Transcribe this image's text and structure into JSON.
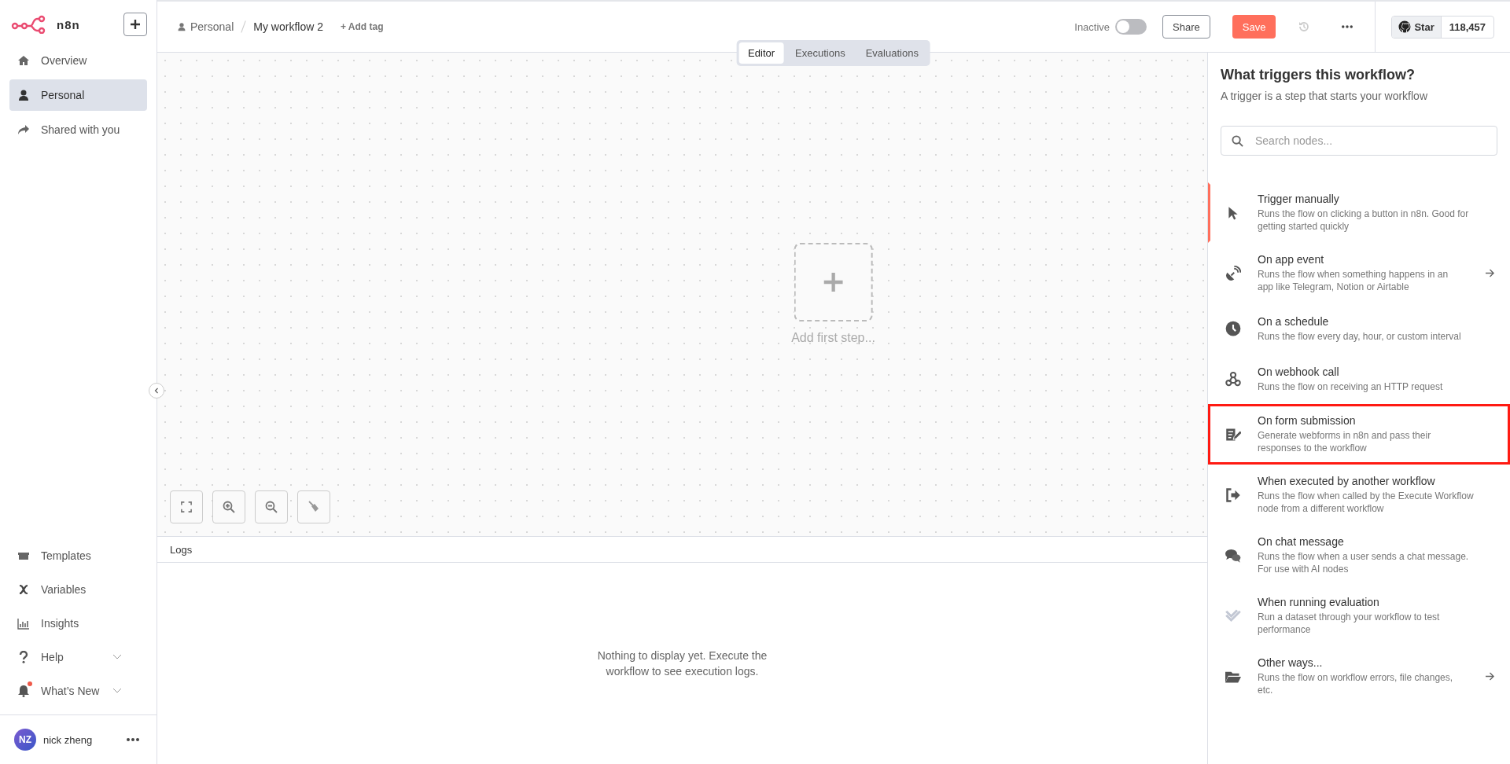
{
  "sidebar": {
    "logo_text": "n8n",
    "top_items": [
      {
        "kind": "home",
        "label": "Overview",
        "selected": false
      },
      {
        "kind": "user",
        "label": "Personal",
        "selected": true
      },
      {
        "kind": "share",
        "label": "Shared with you",
        "selected": false
      }
    ],
    "bottom_items": [
      {
        "kind": "box",
        "label": "Templates",
        "expandable": false,
        "notification": false
      },
      {
        "kind": "variable",
        "label": "Variables",
        "expandable": false,
        "notification": false
      },
      {
        "kind": "chart",
        "label": "Insights",
        "expandable": false,
        "notification": false
      },
      {
        "kind": "question",
        "label": "Help",
        "expandable": true,
        "notification": false
      },
      {
        "kind": "bell",
        "label": "What’s New",
        "expandable": true,
        "notification": true
      }
    ],
    "user": {
      "initials": "NZ",
      "name": "nick zheng"
    }
  },
  "header": {
    "project": "Personal",
    "workflow": "My workflow 2",
    "add_tag": "+ Add tag",
    "status_label": "Inactive",
    "active": false,
    "share": "Share",
    "save": "Save",
    "github": {
      "label": "Star",
      "count": "118,457"
    }
  },
  "view_tabs": [
    {
      "label": "Editor",
      "selected": true
    },
    {
      "label": "Executions",
      "selected": false
    },
    {
      "label": "Evaluations",
      "selected": false
    }
  ],
  "canvas": {
    "add_first_step": "Add first step..."
  },
  "logs": {
    "title": "Logs",
    "empty_message": "Nothing to display yet. Execute the workflow to see execution logs."
  },
  "trigger_panel": {
    "title": "What triggers this workflow?",
    "subtitle": "A trigger is a step that starts your workflow",
    "search": {
      "placeholder": "Search nodes..."
    },
    "items": [
      {
        "kind": "pointer",
        "title": "Trigger manually",
        "description": "Runs the flow on clicking a button in n8n. Good for getting started quickly",
        "selected": true,
        "has_arrow": false,
        "highlighted": false
      },
      {
        "kind": "satellite",
        "title": "On app event",
        "description": "Runs the flow when something happens in an app like Telegram, Notion or Airtable",
        "selected": false,
        "has_arrow": true,
        "highlighted": false
      },
      {
        "kind": "clock",
        "title": "On a schedule",
        "description": "Runs the flow every day, hour, or custom interval",
        "selected": false,
        "has_arrow": false,
        "highlighted": false
      },
      {
        "kind": "webhook",
        "title": "On webhook call",
        "description": "Runs the flow on receiving an HTTP request",
        "selected": false,
        "has_arrow": false,
        "highlighted": false
      },
      {
        "kind": "form",
        "title": "On form submission",
        "description": "Generate webforms in n8n and pass their responses to the workflow",
        "selected": false,
        "has_arrow": false,
        "highlighted": true
      },
      {
        "kind": "exit",
        "title": "When executed by another workflow",
        "description": "Runs the flow when called by the Execute Workflow node from a different workflow",
        "selected": false,
        "has_arrow": false,
        "highlighted": false
      },
      {
        "kind": "chat",
        "title": "On chat message",
        "description": "Runs the flow when a user sends a chat message. For use with AI nodes",
        "selected": false,
        "has_arrow": false,
        "highlighted": false
      },
      {
        "kind": "check",
        "title": "When running evaluation",
        "description": "Run a dataset through your workflow to test performance",
        "selected": false,
        "has_arrow": false,
        "highlighted": false
      },
      {
        "kind": "folder",
        "title": "Other ways...",
        "description": "Runs the flow on workflow errors, file changes, etc.",
        "selected": false,
        "has_arrow": true,
        "highlighted": false
      }
    ]
  }
}
